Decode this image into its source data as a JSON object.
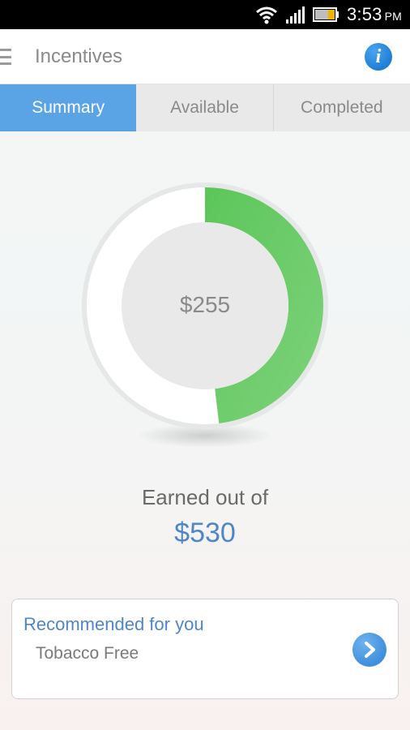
{
  "status_bar": {
    "time": "3:53",
    "ampm": "PM",
    "wifi_icon": "wifi-icon",
    "signal_icon": "signal-icon",
    "battery_icon": "battery-icon"
  },
  "app_bar": {
    "menu_icon": "menu-icon",
    "title": "Incentives",
    "info_icon": "info-icon",
    "info_glyph": "i"
  },
  "tabs": [
    {
      "label": "Summary",
      "active": true
    },
    {
      "label": "Available",
      "active": false
    },
    {
      "label": "Completed",
      "active": false
    }
  ],
  "summary": {
    "earned_display": "$255",
    "earned_amount": 255,
    "total_amount": 530,
    "earned_label": "Earned out of",
    "total_display": "$530"
  },
  "recommendation": {
    "title": "Recommended for you",
    "item": "Tobacco Free",
    "arrow_icon": "chevron-right-icon"
  },
  "colors": {
    "accent_blue": "#5aa4e6",
    "progress_green": "#6cc96a",
    "text_blue": "#4f86c6"
  }
}
